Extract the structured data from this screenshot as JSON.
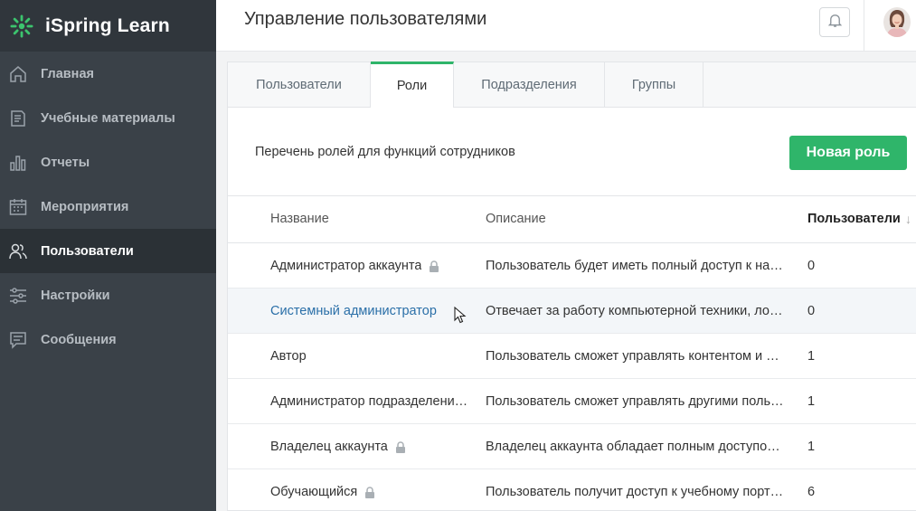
{
  "app": {
    "name": "iSpring Learn",
    "brand_color": "#2fb56a"
  },
  "sidebar": {
    "items": [
      {
        "label": "Главная",
        "icon": "home-icon"
      },
      {
        "label": "Учебные материалы",
        "icon": "document-icon"
      },
      {
        "label": "Отчеты",
        "icon": "bar-chart-icon"
      },
      {
        "label": "Мероприятия",
        "icon": "calendar-icon"
      },
      {
        "label": "Пользователи",
        "icon": "users-icon",
        "active": true
      },
      {
        "label": "Настройки",
        "icon": "sliders-icon"
      },
      {
        "label": "Сообщения",
        "icon": "message-icon"
      }
    ]
  },
  "header": {
    "title": "Управление пользователями"
  },
  "tabs": [
    {
      "label": "Пользователи"
    },
    {
      "label": "Роли",
      "active": true
    },
    {
      "label": "Подразделения"
    },
    {
      "label": "Группы"
    }
  ],
  "toolbar": {
    "description": "Перечень ролей для функций сотрудников",
    "new_role_label": "Новая роль"
  },
  "table": {
    "columns": {
      "name": "Название",
      "description": "Описание",
      "users": "Пользователи"
    },
    "rows": [
      {
        "name": "Администратор аккаунта",
        "locked": true,
        "description": "Пользователь будет иметь полный доступ к на…",
        "users": "0"
      },
      {
        "name": "Системный администратор",
        "locked": false,
        "description": "Отвечает за работу компьютерной техники, ло…",
        "users": "0"
      },
      {
        "name": "Автор",
        "locked": false,
        "description": "Пользователь сможет управлять контентом и …",
        "users": "1"
      },
      {
        "name": "Администратор подразделени…",
        "locked": false,
        "description": "Пользователь сможет управлять другими поль…",
        "users": "1"
      },
      {
        "name": "Владелец аккаунта",
        "locked": true,
        "description": "Владелец аккаунта обладает полным доступо…",
        "users": "1"
      },
      {
        "name": "Обучающийся",
        "locked": true,
        "description": "Пользователь получит доступ к учебному порт…",
        "users": "6"
      }
    ]
  }
}
